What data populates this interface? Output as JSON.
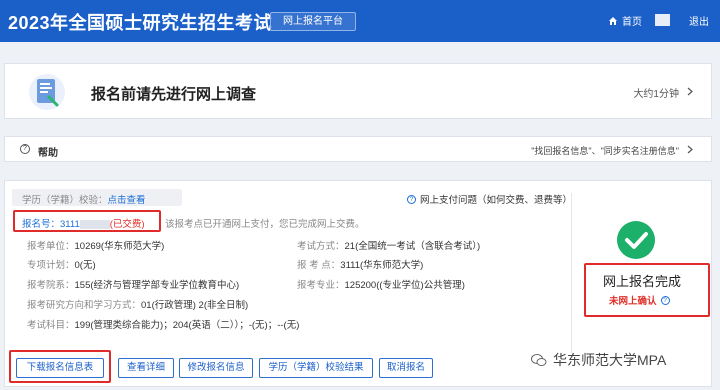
{
  "header": {
    "title": "2023年全国硕士研究生招生考试",
    "badge": "网上报名平台",
    "home": "首页",
    "logout": "退出"
  },
  "survey": {
    "text": "报名前请先进行网上调查",
    "duration": "大约1分钟"
  },
  "help": {
    "label": "帮助",
    "links": "\"找回报名信息\"、\"同步实名注册信息\""
  },
  "registration": {
    "verify_label": "学历（学籍）校验：",
    "verify_link": "点击查看",
    "payment_issue": "网上支付问题（如何交费、退费等）",
    "reg_no_label": "报名号：",
    "reg_no_value": "3111",
    "paid_status": "(已交费)",
    "paid_note": "该报考点已开通网上支付，您已完成网上交费。",
    "fields": {
      "unit_label": "报考单位：",
      "unit_value": "10269(华东师范大学)",
      "exam_mode_label": "考试方式：",
      "exam_mode_value": "21(全国统一考试（含联合考试）)",
      "plan_label": "专项计划：",
      "plan_value": "0(无)",
      "site_label": "报 考 点：",
      "site_value": "3111(华东师范大学)",
      "dept_label": "报考院系：",
      "dept_value": "155(经济与管理学部专业学位教育中心)",
      "major_label": "报考专业：",
      "major_value": "125200((专业学位)公共管理)",
      "direction_label": "报考研究方向和学习方式：",
      "direction_value": "01(行政管理) 2(非全日制)",
      "subjects_label": "考试科目：",
      "subjects_value": "199(管理类综合能力)；204(英语（二））；-(无)；--(无)"
    },
    "status_title": "网上报名完成",
    "status_sub": "未网上确认"
  },
  "buttons": {
    "download": "下载报名信息表",
    "details": "查看详细",
    "modify": "修改报名信息",
    "verify_result": "学历（学籍）校验结果",
    "cancel": "取消报名"
  },
  "watermark": "华东师范大学MPA",
  "colors": {
    "brand_blue": "#1b5fc9",
    "success_green": "#1cb06a",
    "alert_red": "#e0302a"
  }
}
